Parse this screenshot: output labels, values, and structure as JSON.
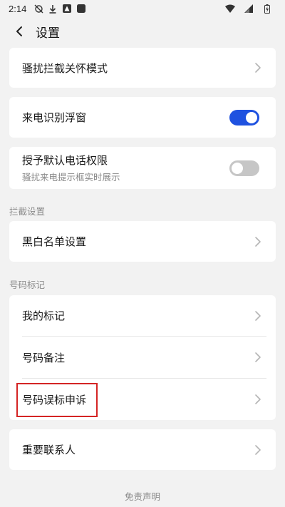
{
  "status_bar": {
    "time": "2:14"
  },
  "header": {
    "title": "设置"
  },
  "cards": {
    "harass_mode": {
      "label": "骚扰拦截关怀模式"
    },
    "caller_id_float": {
      "label": "来电识别浮窗",
      "enabled": true
    },
    "default_phone": {
      "label": "授予默认电话权限",
      "sub": "骚扰来电提示框实时展示",
      "enabled": false
    },
    "blackwhite": {
      "label": "黑白名单设置"
    },
    "my_marks": {
      "label": "我的标记"
    },
    "number_note": {
      "label": "号码备注"
    },
    "mark_appeal": {
      "label": "号码误标申诉"
    },
    "important_contacts": {
      "label": "重要联系人"
    }
  },
  "sections": {
    "intercept": "拦截设置",
    "number_mark": "号码标记"
  },
  "footer": {
    "disclaimer": "免责声明"
  },
  "colors": {
    "accent": "#1f52e0",
    "highlight_box": "#d42424",
    "toggle_off": "#c6c6c6"
  }
}
